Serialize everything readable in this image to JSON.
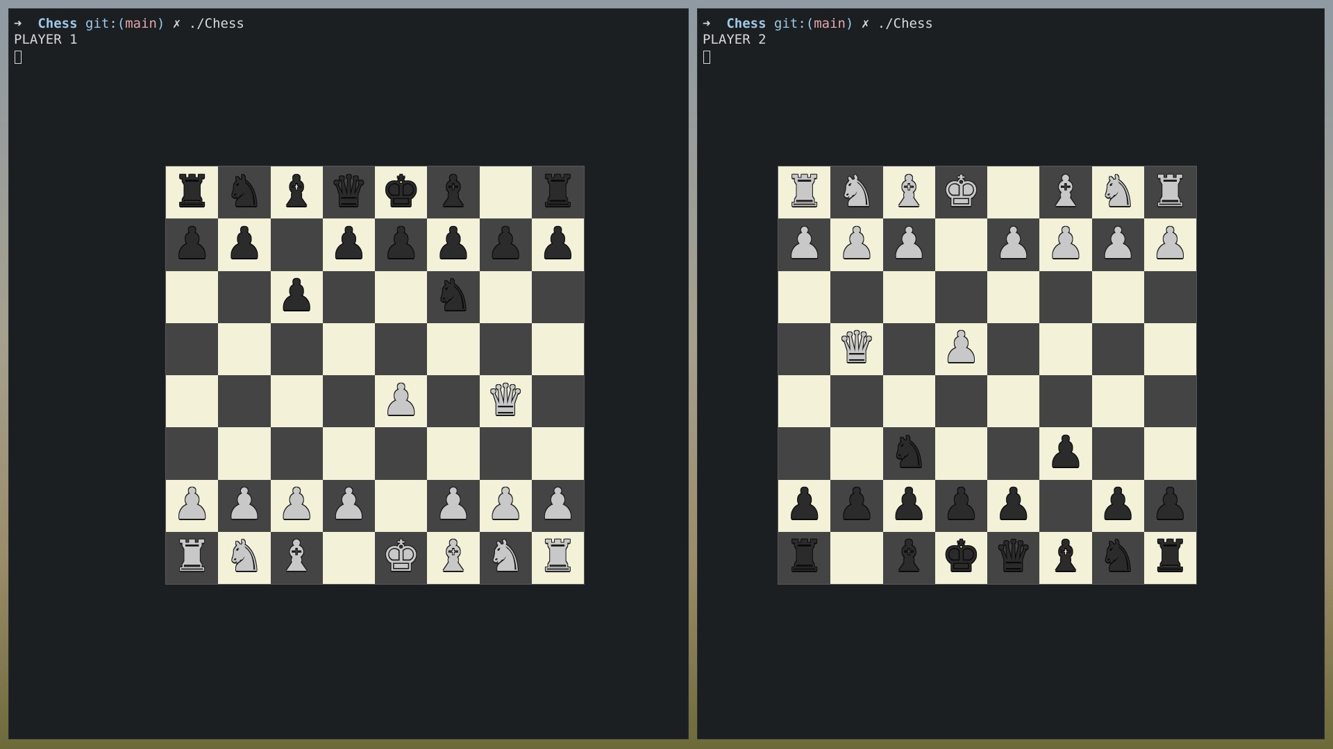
{
  "colors": {
    "terminal_bg": "#1c1f22",
    "light_square": "#f3f1d8",
    "dark_square": "#444444",
    "white_piece": "#c8c8c8",
    "black_piece": "#2b2b2b",
    "prompt_dir": "#9fc9e8",
    "prompt_branch": "#e0a8ae"
  },
  "terminals": [
    {
      "prompt": {
        "arrow": "➜",
        "dir": "Chess",
        "git": "git:(",
        "branch": "main",
        "git_close": ")",
        "dirty": "✗",
        "command": "./Chess"
      },
      "player_label": "PLAYER 1",
      "board": [
        [
          "br",
          "bn",
          "bb",
          "bq",
          "bk",
          "bb",
          "",
          "br"
        ],
        [
          "bp",
          "bp",
          "",
          "bp",
          "bp",
          "bp",
          "bp",
          "bp"
        ],
        [
          "",
          "",
          "bp",
          "",
          "",
          "bn",
          "",
          ""
        ],
        [
          "",
          "",
          "",
          "",
          "",
          "",
          "",
          ""
        ],
        [
          "",
          "",
          "",
          "",
          "wp",
          "",
          "wq",
          ""
        ],
        [
          "",
          "",
          "",
          "",
          "",
          "",
          "",
          ""
        ],
        [
          "wp",
          "wp",
          "wp",
          "wp",
          "",
          "wp",
          "wp",
          "wp"
        ],
        [
          "wr",
          "wn",
          "wb",
          "",
          "wk",
          "wb",
          "wn",
          "wr"
        ]
      ]
    },
    {
      "prompt": {
        "arrow": "➜",
        "dir": "Chess",
        "git": "git:(",
        "branch": "main",
        "git_close": ")",
        "dirty": "✗",
        "command": "./Chess"
      },
      "player_label": "PLAYER 2",
      "board": [
        [
          "wr",
          "wn",
          "wb",
          "wk",
          "",
          "wb",
          "wn",
          "wr"
        ],
        [
          "wp",
          "wp",
          "wp",
          "",
          "wp",
          "wp",
          "wp",
          "wp"
        ],
        [
          "",
          "",
          "",
          "",
          "",
          "",
          "",
          ""
        ],
        [
          "",
          "wq",
          "",
          "wp",
          "",
          "",
          "",
          ""
        ],
        [
          "",
          "",
          "",
          "",
          "",
          "",
          "",
          ""
        ],
        [
          "",
          "",
          "bn",
          "",
          "",
          "bp",
          "",
          ""
        ],
        [
          "bp",
          "bp",
          "bp",
          "bp",
          "bp",
          "",
          "bp",
          "bp"
        ],
        [
          "br",
          "",
          "bb",
          "bk",
          "bq",
          "bb",
          "bn",
          "br"
        ]
      ]
    }
  ]
}
